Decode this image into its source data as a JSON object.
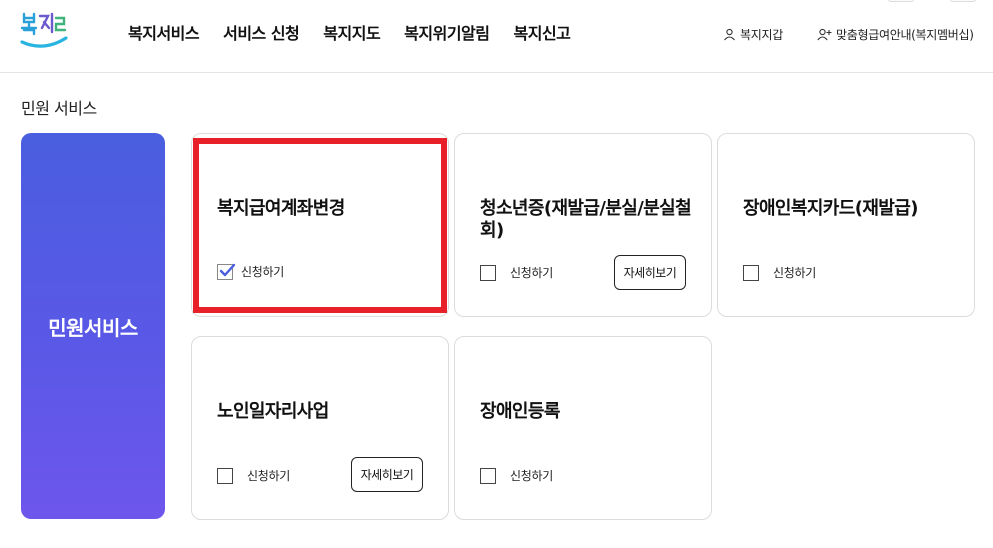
{
  "header": {
    "logo_alt": "복지로",
    "nav": [
      "복지서비스",
      "서비스 신청",
      "복지지도",
      "복지위기알림",
      "복지신고"
    ],
    "wallet_label": "복지지갑",
    "guide_label": "맞춤형급여안내(복지멤버십)"
  },
  "section": {
    "title": "민원 서비스"
  },
  "category": {
    "label": "민원서비스"
  },
  "cards": [
    {
      "title": "복지급여계좌변경",
      "apply_label": "신청하기",
      "checked": true,
      "detail_label": ""
    },
    {
      "title": "청소년증(재발급/분실/분실철회)",
      "apply_label": "신청하기",
      "checked": false,
      "detail_label": "자세히보기"
    },
    {
      "title": "장애인복지카드(재발급)",
      "apply_label": "신청하기",
      "checked": false,
      "detail_label": ""
    },
    {
      "title": "노인일자리사업",
      "apply_label": "신청하기",
      "checked": false,
      "detail_label": "자세히보기"
    },
    {
      "title": "장애인등록",
      "apply_label": "신청하기",
      "checked": false,
      "detail_label": ""
    }
  ],
  "colors": {
    "accent": "#5a58e6",
    "highlight": "#e8202a",
    "check": "#4a5ee0"
  }
}
